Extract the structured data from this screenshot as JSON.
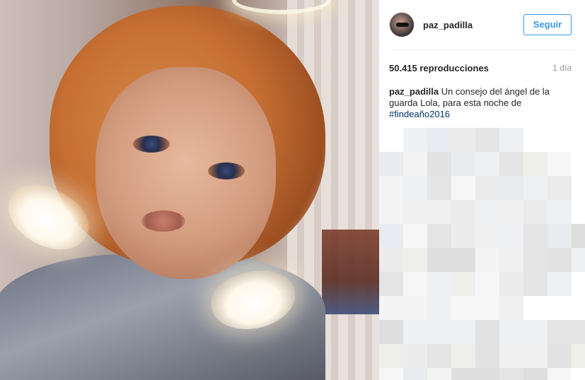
{
  "post": {
    "author": "paz_padilla",
    "follow_label": "Seguir",
    "views": "50.415 reproducciones",
    "time_ago": "1 día",
    "caption_author": "paz_padilla",
    "caption_text": " Un consejo del ángel de la guarda Lola, para esta noche de ",
    "caption_hashtag": "#findeaño2016"
  },
  "colors": {
    "accent": "#3897f0",
    "hashtag": "#003569",
    "muted": "#999999"
  },
  "comments_pixelated": true
}
